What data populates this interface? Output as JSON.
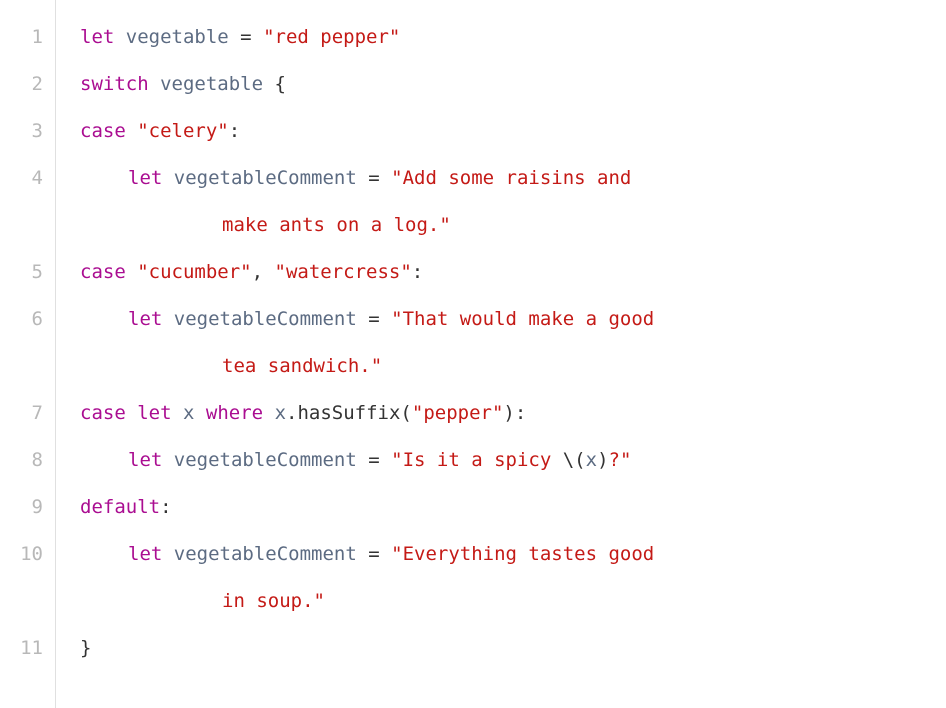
{
  "gutter": {
    "lines": [
      "1",
      "2",
      "3",
      "4",
      "5",
      "6",
      "7",
      "8",
      "9",
      "10",
      "11"
    ],
    "wrapped_lines": [
      4,
      6,
      10
    ]
  },
  "code": {
    "line1": {
      "kw_let": "let",
      "ident": "vegetable",
      "eq": " = ",
      "str": "\"red pepper\""
    },
    "line2": {
      "kw_switch": "switch",
      "ident": "vegetable",
      "brace": " {"
    },
    "line3": {
      "kw_case": "case",
      "str": "\"celery\"",
      "colon": ":"
    },
    "line4": {
      "kw_let": "let",
      "ident": "vegetableComment",
      "eq": " = ",
      "str_part1": "\"Add some raisins and ",
      "str_part2": "make ants on a log.\""
    },
    "line5": {
      "kw_case": "case",
      "str1": "\"cucumber\"",
      "comma": ", ",
      "str2": "\"watercress\"",
      "colon": ":"
    },
    "line6": {
      "kw_let": "let",
      "ident": "vegetableComment",
      "eq": " = ",
      "str_part1": "\"That would make a good ",
      "str_part2": "tea sandwich.\""
    },
    "line7": {
      "kw_case": "case",
      "kw_let": "let",
      "var_x": "x",
      "kw_where": "where",
      "var_x2": "x",
      "dot": ".",
      "method": "hasSuffix",
      "paren_open": "(",
      "str": "\"pepper\"",
      "paren_close": ")",
      "colon": ":"
    },
    "line8": {
      "kw_let": "let",
      "ident": "vegetableComment",
      "eq": " = ",
      "str_part1": "\"Is it a spicy ",
      "interp_open": "\\(",
      "var_x": "x",
      "interp_close": ")",
      "str_part2": "?\""
    },
    "line9": {
      "kw_default": "default",
      "colon": ":"
    },
    "line10": {
      "kw_let": "let",
      "ident": "vegetableComment",
      "eq": " = ",
      "str_part1": "\"Everything tastes good ",
      "str_part2": "in soup.\""
    },
    "line11": {
      "brace": "}"
    }
  }
}
